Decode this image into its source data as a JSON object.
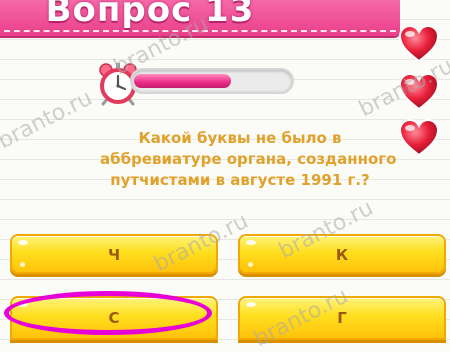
{
  "header": {
    "title": "Вопрос 13"
  },
  "timer": {
    "remaining_fraction": 0.62
  },
  "lives": {
    "count": 3,
    "icon": "heart-icon",
    "color": "#e8203a"
  },
  "question": {
    "lines": [
      "Какой буквы не было в",
      "аббревиатуре органа, созданного",
      "путчистами в августе 1991 г.?"
    ]
  },
  "answers": [
    {
      "label": "Ч"
    },
    {
      "label": "К"
    },
    {
      "label": "С",
      "highlighted": true
    },
    {
      "label": "Г"
    }
  ],
  "watermark": {
    "text": "branto.ru"
  },
  "colors": {
    "header_pink": "#ea3f8a",
    "question_text": "#e0a22a",
    "answer_yellow": "#ffdf1f",
    "answer_text": "#9b5a12",
    "highlight": "#e800d9"
  }
}
